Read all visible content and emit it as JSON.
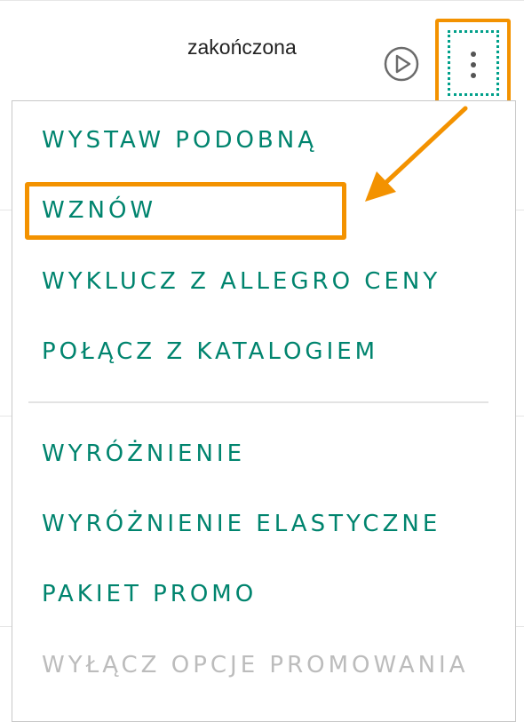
{
  "status": {
    "label": "zakończona"
  },
  "icons": {
    "play": "play-circle-icon",
    "more": "vertical-ellipsis-icon"
  },
  "menu": {
    "items": [
      {
        "label": "WYSTAW PODOBNĄ",
        "enabled": true
      },
      {
        "label": "WZNÓW",
        "enabled": true,
        "highlighted": true
      },
      {
        "label": "WYKLUCZ Z ALLEGRO CENY",
        "enabled": true
      },
      {
        "label": "POŁĄCZ Z KATALOGIEM",
        "enabled": true
      },
      {
        "label": "WYRÓŻNIENIE",
        "enabled": true
      },
      {
        "label": "WYRÓŻNIENIE ELASTYCZNE",
        "enabled": true
      },
      {
        "label": "PAKIET PROMO",
        "enabled": true
      },
      {
        "label": "WYŁĄCZ OPCJE PROMOWANIA",
        "enabled": false
      }
    ]
  },
  "colors": {
    "accent_teal": "#00846e",
    "annotation_orange": "#f39200",
    "disabled_gray": "#bcbcbc"
  }
}
